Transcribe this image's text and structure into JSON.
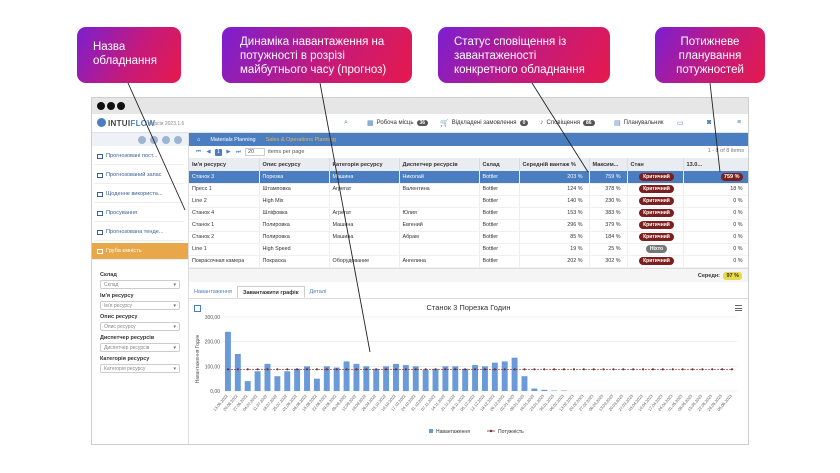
{
  "callouts": {
    "equipment_name": "Назва обладнання",
    "load_dynamics": "Динаміка навантаження на потужності в розрізі майбутнього часу (прогноз)",
    "notification_status": "Статус сповіщення із завантаженості конкретного обладнання",
    "capacity_planning": "Потижневе планування потужностей"
  },
  "app": {
    "logo_text_a": "INTUI",
    "logo_text_b": "FLOW",
    "version": "версія 2023.1.6",
    "topbar": {
      "workplace": "Робоча місць",
      "workplace_count": "36",
      "deferred_orders": "Відкладені замовлення",
      "deferred_count": "0",
      "notifications": "Сповіщення",
      "notifications_count": "86",
      "planner": "Планувальник"
    }
  },
  "sidebar": {
    "items": [
      {
        "label": "Прогнозовані пост..."
      },
      {
        "label": "Прогнозований запас"
      },
      {
        "label": "Щоденне використа..."
      },
      {
        "label": "Просування"
      },
      {
        "label": "Прогнозована тенде..."
      },
      {
        "label": "Груба ємність"
      }
    ],
    "filters": [
      {
        "label": "Склад",
        "placeholder": "Склад"
      },
      {
        "label": "Ім'я ресурсу",
        "placeholder": "Ім'я ресурсу"
      },
      {
        "label": "Опис ресурсу",
        "placeholder": "Опис ресурсу"
      },
      {
        "label": "Диспетчер ресурсів",
        "placeholder": "Диспетчер ресурсів"
      },
      {
        "label": "Категорія ресурсу",
        "placeholder": "Категорія ресурсу"
      }
    ]
  },
  "breadcrumb": {
    "home": "⌂",
    "first": "Materials Planning",
    "second": "Sales & Operations Planning"
  },
  "pager": {
    "page": "1",
    "page_size": "20",
    "per_page": "items per page",
    "info": "1 - 8 of 8 items"
  },
  "table": {
    "columns": [
      "Ім'я ресурсу",
      "Опис ресурсу",
      "Категорія ресурсу",
      "Диспетчер ресурсів",
      "Склад",
      "Середній вантаж %",
      "Максим...",
      "Стан",
      "13.0..."
    ],
    "rows": [
      [
        "Станок 3",
        "Порезка",
        "Машина",
        "Николай",
        "Bottler",
        "203 %",
        "759 %",
        "Критичний",
        "759 %"
      ],
      [
        "Пресс 1",
        "Штамповка",
        "Агрегат",
        "Валентина",
        "Bottler",
        "124 %",
        "378 %",
        "Критичний",
        "18 %"
      ],
      [
        "Line 2",
        "High Mix",
        "",
        "",
        "Bottler",
        "140 %",
        "230 %",
        "Критичний",
        "0 %"
      ],
      [
        "Станок 4",
        "Шліфовка",
        "Агрегат",
        "Юлия",
        "Bottler",
        "153 %",
        "383 %",
        "Критичний",
        "0 %"
      ],
      [
        "Станок 1",
        "Полировка",
        "Машина",
        "Евгений",
        "Bottler",
        "296 %",
        "379 %",
        "Критичний",
        "0 %"
      ],
      [
        "Станок 2",
        "Полировка",
        "Машина",
        "Абрам",
        "Bottler",
        "85 %",
        "184 %",
        "Критичний",
        "0 %"
      ],
      [
        "Line 1",
        "High Speed",
        "",
        "",
        "Bottler",
        "19 %",
        "25 %",
        "Ніхто",
        "0 %"
      ],
      [
        "Покрасочная камера",
        "Покраска",
        "Оборудование",
        "Ангелина",
        "Bottler",
        "202 %",
        "302 %",
        "Критичний",
        "0 %"
      ]
    ],
    "footer_label": "Середн:",
    "footer_value": "97 %"
  },
  "tabs": [
    "Навантаження",
    "Завантажити графік",
    "Деталі"
  ],
  "chart_data": {
    "type": "bar",
    "title": "Станок 3 Порезка Годин",
    "ylabel": "Навантаження Годин",
    "ylim": [
      0,
      300
    ],
    "yticks": [
      "300,00",
      "200,00",
      "100,00",
      "0,00"
    ],
    "categories": [
      "13.06.2022",
      "20.06.2022",
      "27.06.2022",
      "04.07.2022",
      "11.07.2022",
      "18.07.2022",
      "25.07.2022",
      "01.08.2022",
      "08.08.2022",
      "15.08.2022",
      "22.08.2022",
      "29.08.2022",
      "05.09.2022",
      "12.09.2022",
      "19.09.2022",
      "26.09.2022",
      "03.10.2022",
      "10.10.2022",
      "17.10.2022",
      "24.10.2022",
      "31.10.2022",
      "07.11.2022",
      "14.11.2022",
      "21.11.2022",
      "28.11.2022",
      "05.12.2022",
      "12.12.2022",
      "19.12.2022",
      "26.12.2022",
      "02.01.2023",
      "09.01.2023",
      "16.01.2023",
      "23.01.2023",
      "30.01.2023",
      "06.02.2023",
      "13.02.2023",
      "20.02.2023",
      "27.02.2023",
      "06.03.2023",
      "13.03.2023",
      "20.03.2023",
      "27.03.2023",
      "03.04.2023",
      "10.04.2023",
      "17.04.2023",
      "24.04.2023",
      "01.05.2023",
      "08.05.2023",
      "15.05.2023",
      "22.05.2023",
      "29.05.2023",
      "05.06.2023"
    ],
    "series": [
      {
        "name": "Навантаження",
        "color": "#6a9bd8",
        "values": [
          240,
          150,
          40,
          80,
          110,
          60,
          80,
          90,
          100,
          50,
          100,
          95,
          120,
          110,
          100,
          90,
          100,
          110,
          105,
          100,
          85,
          90,
          100,
          100,
          90,
          105,
          100,
          115,
          120,
          135,
          60,
          10,
          5,
          2,
          2,
          0,
          0,
          0,
          0,
          0,
          0,
          0,
          0,
          0,
          0,
          0,
          0,
          0,
          0,
          0,
          0,
          0
        ]
      },
      {
        "name": "Потужність",
        "color": "#7a2a2a",
        "values": [
          88,
          88,
          88,
          88,
          88,
          88,
          88,
          88,
          88,
          88,
          88,
          88,
          88,
          88,
          88,
          88,
          88,
          88,
          88,
          88,
          88,
          88,
          88,
          88,
          88,
          88,
          88,
          88,
          88,
          88,
          88,
          88,
          88,
          88,
          88,
          88,
          88,
          88,
          88,
          88,
          88,
          88,
          88,
          88,
          88,
          88,
          88,
          88,
          88,
          88,
          88,
          88
        ]
      }
    ]
  }
}
